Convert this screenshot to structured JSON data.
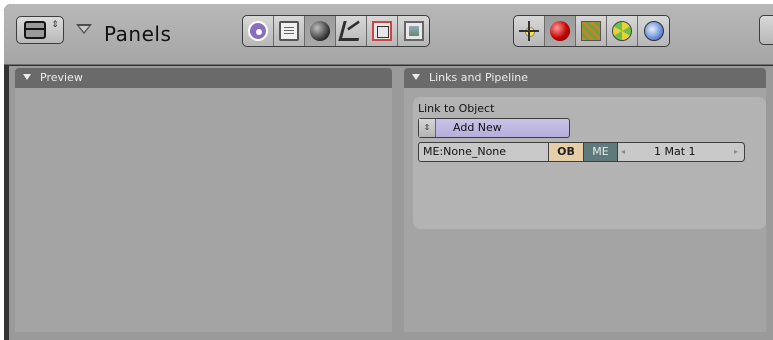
{
  "header": {
    "title": "Panels",
    "window_type_arrows": "⇕",
    "context_icons_group_1": [
      "logic-icon",
      "script-icon",
      "shading-icon",
      "object-icon",
      "editing-icon",
      "scene-icon"
    ],
    "active_context": "shading",
    "context_icons_group_2": [
      "lamp-icon",
      "material-icon",
      "texture-icon",
      "radiosity-icon",
      "world-icon"
    ]
  },
  "panels": {
    "preview": {
      "title": "Preview"
    },
    "links": {
      "title": "Links and Pipeline",
      "link_to_object_label": "Link to Object",
      "add_new_label": "Add New",
      "add_new_spinner": "⇕",
      "mesh_name": "ME:None_None",
      "ob_label": "OB",
      "me_label": "ME",
      "material_slot": "1 Mat 1",
      "material_prev_arrow": "◂",
      "material_next_arrow": "▸"
    }
  },
  "colors": {
    "frame": "#323232",
    "header": "#b0b0b0",
    "panel_body": "#a4a4a4",
    "panel_head": "#6a6a6a",
    "add_new": "#beb6e0",
    "ob_toggle": "#e6cfa8",
    "me_toggle": "#5f7a7a"
  }
}
